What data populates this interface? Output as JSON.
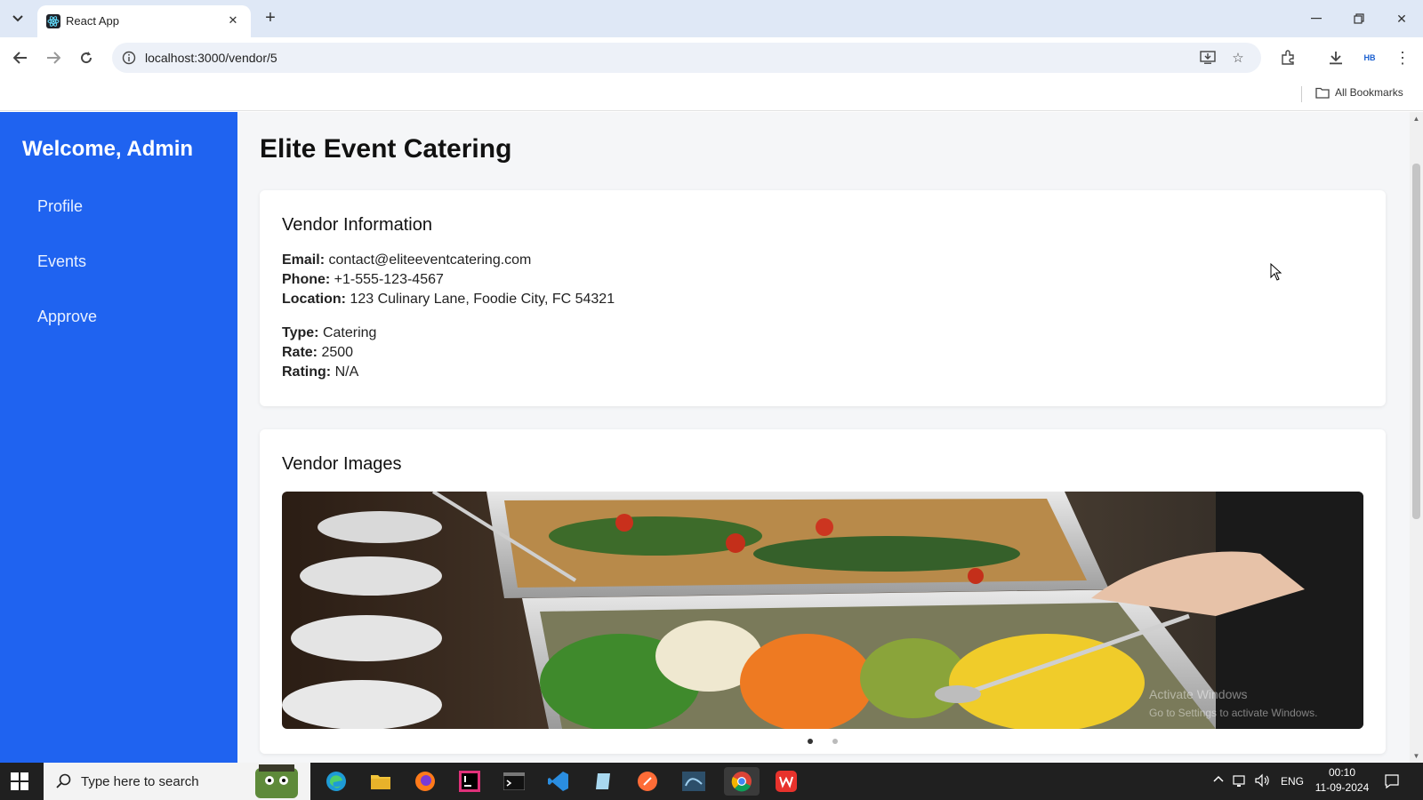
{
  "browser": {
    "tab_title": "React App",
    "url": "localhost:3000/vendor/5",
    "bookmarks_label": "All Bookmarks"
  },
  "sidebar": {
    "welcome": "Welcome, Admin",
    "items": [
      {
        "label": "Profile"
      },
      {
        "label": "Events"
      },
      {
        "label": "Approve"
      }
    ]
  },
  "page": {
    "title": "Elite Event Catering",
    "vendor_info": {
      "heading": "Vendor Information",
      "email_label": "Email:",
      "email": "contact@eliteeventcatering.com",
      "phone_label": "Phone:",
      "phone": "+1-555-123-4567",
      "location_label": "Location:",
      "location": "123 Culinary Lane, Foodie City, FC 54321",
      "type_label": "Type:",
      "type": "Catering",
      "rate_label": "Rate:",
      "rate": "2500",
      "rating_label": "Rating:",
      "rating": "N/A"
    },
    "vendor_images": {
      "heading": "Vendor Images",
      "slides": 2,
      "active_slide": 1
    }
  },
  "taskbar": {
    "search_placeholder": "Type here to search",
    "language": "ENG",
    "time": "00:10",
    "date": "11-09-2024"
  },
  "watermark": {
    "line1": "Activate Windows",
    "line2": "Go to Settings to activate Windows."
  },
  "colors": {
    "sidebar": "#1f63f0",
    "tabbar": "#dfe8f6",
    "taskbar": "#202020"
  }
}
